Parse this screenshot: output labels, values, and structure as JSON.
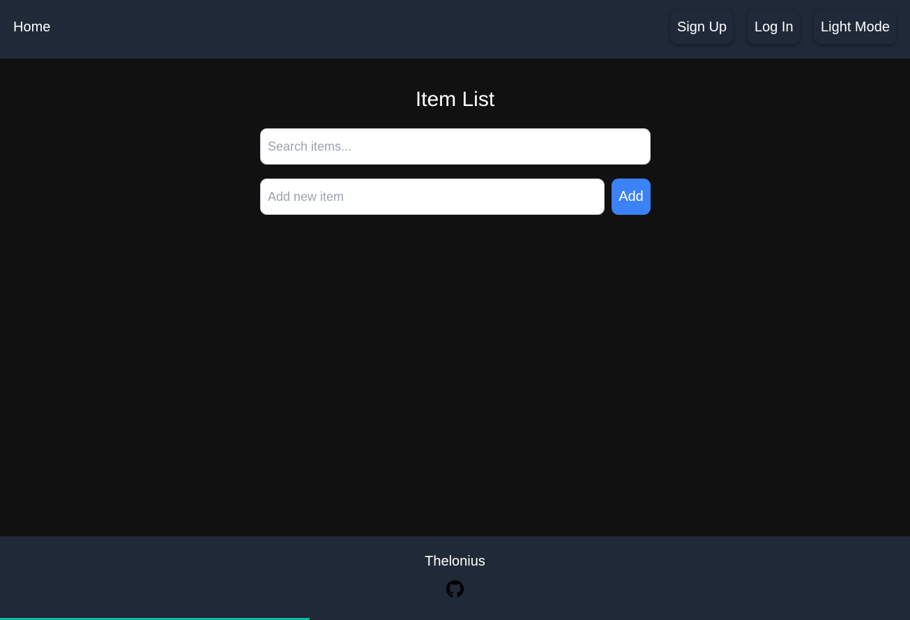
{
  "navbar": {
    "home_label": "Home",
    "buttons": {
      "signup": "Sign Up",
      "login": "Log In",
      "light_mode": "Light Mode"
    }
  },
  "main": {
    "title": "Item List",
    "search": {
      "placeholder": "Search items...",
      "value": ""
    },
    "new_item": {
      "placeholder": "Add new item",
      "value": ""
    },
    "add_button": "Add",
    "items": []
  },
  "footer": {
    "name": "Thelonius",
    "icon": "github-icon"
  },
  "colors": {
    "background": "#111111",
    "navbar": "#1f2937",
    "accent": "#3b82f6",
    "text": "#ffffff",
    "placeholder": "#9ca3af",
    "progress": "#14b8a6"
  }
}
